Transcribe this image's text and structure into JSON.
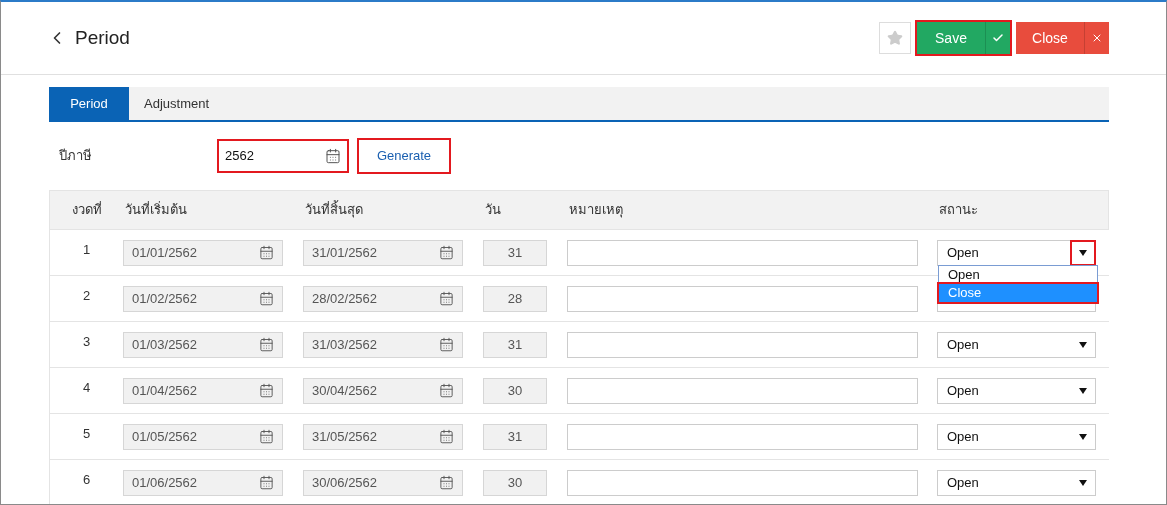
{
  "header": {
    "title": "Period",
    "buttons": [
      {
        "label": "Save",
        "kind": "save",
        "highlighted": true
      },
      {
        "label": "Close",
        "kind": "close",
        "highlighted": false
      }
    ]
  },
  "tabs": [
    {
      "label": "Period",
      "selected": true
    },
    {
      "label": "Adjustment",
      "selected": false
    }
  ],
  "year": {
    "label": "ปีภาษี",
    "value": "2562",
    "highlighted": true
  },
  "generate": {
    "label": "Generate",
    "highlighted": true
  },
  "table": {
    "columns": [
      "งวดที่",
      "วันที่เริ่มต้น",
      "วันที่สิ้นสุด",
      "วัน",
      "หมายเหตุ",
      "สถานะ"
    ],
    "rows": [
      {
        "no": "1",
        "start": "01/01/2562",
        "end": "31/01/2562",
        "days": "31",
        "status": "Open",
        "caret_highlighted": true,
        "dropdown": [
          {
            "label": "Open",
            "selected": false,
            "highlighted": false
          },
          {
            "label": "Close",
            "selected": true,
            "highlighted": true
          }
        ]
      },
      {
        "no": "2",
        "start": "01/02/2562",
        "end": "28/02/2562",
        "days": "28"
      },
      {
        "no": "3",
        "start": "01/03/2562",
        "end": "31/03/2562",
        "days": "31",
        "status": "Open"
      },
      {
        "no": "4",
        "start": "01/04/2562",
        "end": "30/04/2562",
        "days": "30",
        "status": "Open"
      },
      {
        "no": "5",
        "start": "01/05/2562",
        "end": "31/05/2562",
        "days": "31",
        "status": "Open"
      },
      {
        "no": "6",
        "start": "01/06/2562",
        "end": "30/06/2562",
        "days": "30",
        "status": "Open"
      }
    ]
  }
}
